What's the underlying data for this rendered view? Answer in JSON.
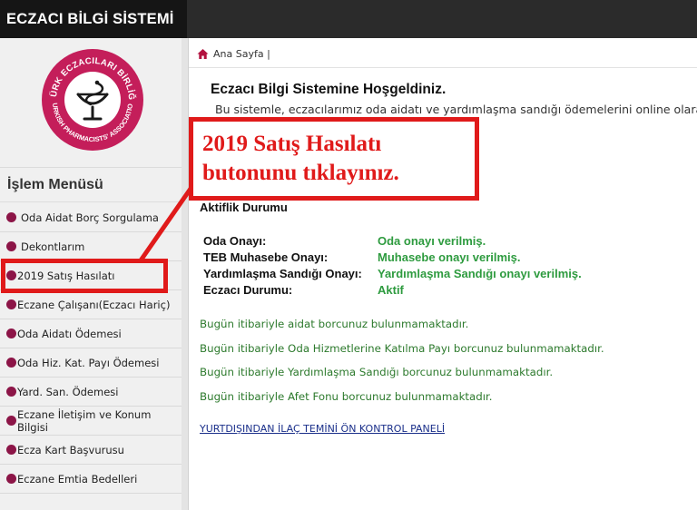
{
  "app": {
    "title": "ECZACI BİLGİ SİSTEMİ"
  },
  "logo": {
    "top_text": "TÜRK ECZACILARI BİRLİĞİ",
    "bottom_text": "TURKISH PHARMACISTS' ASSOCIATION",
    "colors": {
      "ring": "#c41e5a",
      "inner": "#ffffff",
      "emblem": "#1a1a1a"
    }
  },
  "sidebar": {
    "menu_title": "İşlem Menüsü",
    "items": [
      {
        "label": "Oda Aidat Borç Sorgulama"
      },
      {
        "label": "Dekontlarım"
      },
      {
        "label": "2019 Satış Hasılatı"
      },
      {
        "label": "Eczane Çalışanı(Eczacı Hariç)"
      },
      {
        "label": "Oda Aidatı Ödemesi"
      },
      {
        "label": "Oda Hiz. Kat. Payı Ödemesi"
      },
      {
        "label": "Yard. San. Ödemesi"
      },
      {
        "label": "Eczane İletişim ve Konum Bilgisi"
      },
      {
        "label": "Ecza Kart Başvurusu"
      },
      {
        "label": "Eczane Emtia Bedelleri"
      }
    ],
    "bullet_color": "#8c1547"
  },
  "breadcrumb": {
    "icon": "home-icon",
    "label": "Ana Sayfa |"
  },
  "main": {
    "welcome": "Eczacı Bilgi Sistemine Hoşgeldiniz.",
    "intro": "Bu sistemle, eczacılarımız oda aidatı ve yardımlaşma sandığı ödemelerini online olarak",
    "status_title": "Aktiflik Durumu",
    "status": [
      {
        "key": "Oda Onayı:",
        "value": "Oda onayı verilmiş."
      },
      {
        "key": "TEB Muhasebe Onayı:",
        "value": "Muhasebe onayı verilmiş."
      },
      {
        "key": "Yardımlaşma Sandığı Onayı:",
        "value": "Yardımlaşma Sandığı onayı verilmiş."
      },
      {
        "key": "Eczacı Durumu:",
        "value": "Aktif"
      }
    ],
    "debts": [
      "Bugün itibariyle aidat borcunuz bulunmamaktadır.",
      "Bugün itibariyle Oda Hizmetlerine Katılma Payı borcunuz bulunmamaktadır.",
      "Bugün itibariyle Yardımlaşma Sandığı borcunuz bulunmamaktadır.",
      "Bugün itibariyle Afet Fonu borcunuz bulunmamaktadır."
    ],
    "panel_link": "YURTDIŞINDAN İLAÇ TEMİNİ ÖN KONTROL PANELİ"
  },
  "annotation": {
    "line1": "2019 Satış Hasılatı",
    "line2": "butonunu tıklayınız.",
    "color": "#e01a1a"
  }
}
